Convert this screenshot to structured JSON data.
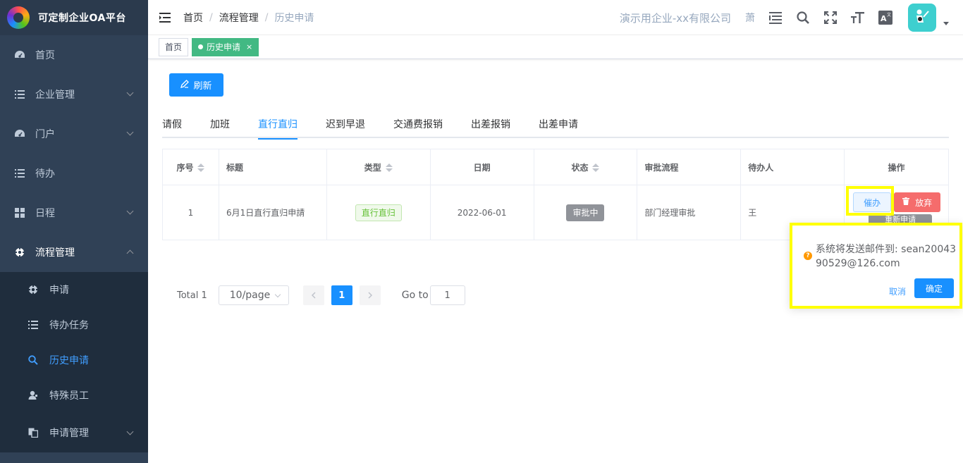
{
  "app": {
    "title": "可定制企业OA平台"
  },
  "sidebar": {
    "items": [
      {
        "label": "首页",
        "icon": "dashboard-icon"
      },
      {
        "label": "企业管理",
        "icon": "list-icon"
      },
      {
        "label": "门户",
        "icon": "dashboard-icon"
      },
      {
        "label": "待办",
        "icon": "list-icon"
      },
      {
        "label": "日程",
        "icon": "grid-icon"
      },
      {
        "label": "流程管理",
        "icon": "target-icon"
      }
    ],
    "sub_items": [
      {
        "label": "申请",
        "icon": "target-icon"
      },
      {
        "label": "待办任务",
        "icon": "list-icon"
      },
      {
        "label": "历史申请",
        "icon": "search-icon"
      },
      {
        "label": "特殊员工",
        "icon": "user-icon"
      },
      {
        "label": "申请管理",
        "icon": "copy-icon"
      }
    ]
  },
  "navbar": {
    "breadcrumb": [
      "首页",
      "流程管理",
      "历史申请"
    ],
    "company": "演示用企业-xx有限公司",
    "char": "萧"
  },
  "tags": {
    "home": "首页",
    "active": "历史申请",
    "close": "×"
  },
  "toolbar": {
    "refresh_label": "刷新"
  },
  "tabs": [
    "请假",
    "加班",
    "直行直归",
    "迟到早退",
    "交通费报销",
    "出差报销",
    "出差申请"
  ],
  "table": {
    "headers": [
      "序号",
      "标题",
      "类型",
      "日期",
      "状态",
      "审批流程",
      "待办人",
      "操作"
    ],
    "rows": [
      {
        "index": "1",
        "title": "6月1日直行直归申請",
        "type": "直行直归",
        "date": "2022-06-01",
        "status": "审批中",
        "flow": "部门经理审批",
        "assignee": "王",
        "urge": "催办",
        "abandon": "放弃",
        "reapply": "重新申请"
      }
    ]
  },
  "pagination": {
    "total": "Total 1",
    "page_size": "10/page",
    "current": "1",
    "goto_label": "Go to",
    "goto_value": "1"
  },
  "popconfirm": {
    "message": "系统将发送邮件到: sean2004390529@126.com",
    "cancel": "取消",
    "confirm": "确定"
  },
  "colors": {
    "primary": "#1890ff",
    "danger": "#f56c6c",
    "success": "#42b983",
    "highlight": "#ffff00",
    "sidebar": "#304156"
  }
}
